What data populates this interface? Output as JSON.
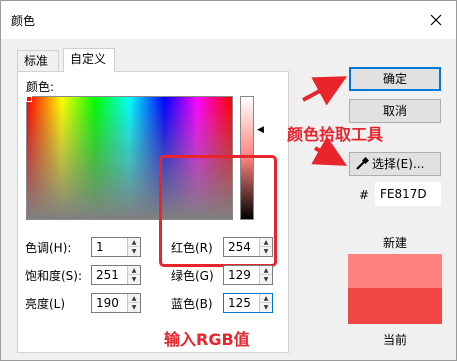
{
  "window": {
    "title": "颜色"
  },
  "tabs": [
    {
      "label": "标准",
      "active": false
    },
    {
      "label": "自定义",
      "active": true
    }
  ],
  "custom": {
    "color_label": "颜色:",
    "fields": {
      "hue": {
        "label": "色调(H):",
        "value": "1"
      },
      "saturation": {
        "label": "饱和度(S):",
        "value": "251"
      },
      "luminance": {
        "label": "亮度(L)",
        "value": "190"
      },
      "red": {
        "label": "红色(R)",
        "value": "254"
      },
      "green": {
        "label": "绿色(G)",
        "value": "129"
      },
      "blue": {
        "label": "蓝色(B)",
        "value": "125"
      }
    }
  },
  "buttons": {
    "ok": "确定",
    "cancel": "取消",
    "select": "选择(E)..."
  },
  "hex": {
    "prefix": "#",
    "value": "FE817D"
  },
  "preview": {
    "new_label": "新建",
    "current_label": "当前",
    "new_color": "#FE817D",
    "current_color": "#F24646"
  },
  "annotations": {
    "picker_tool": "颜色拾取工具",
    "rgb_input": "输入RGB值",
    "color": "#E8242D"
  },
  "icons": [
    "close-icon",
    "eyedropper-icon",
    "spin-up-icon",
    "spin-down-icon",
    "slider-arrow-icon"
  ]
}
